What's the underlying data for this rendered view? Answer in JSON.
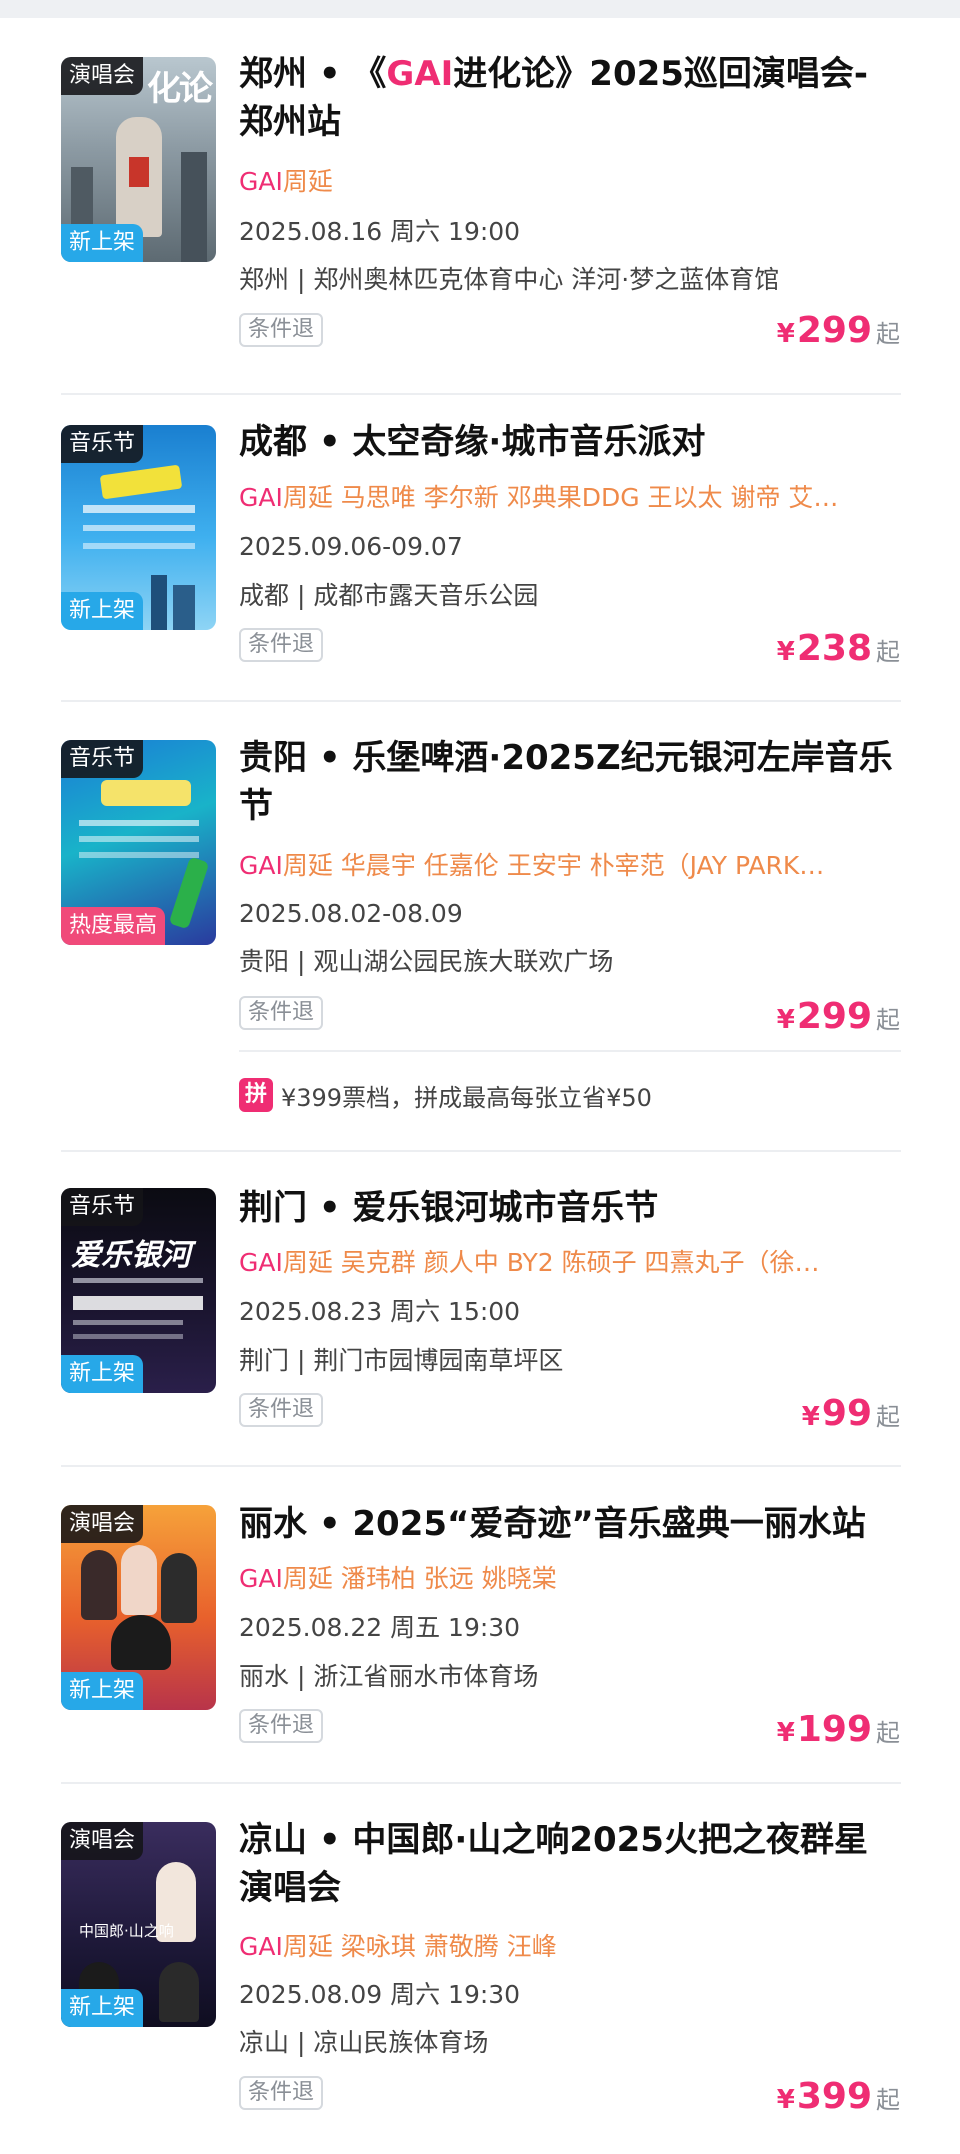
{
  "events": [
    {
      "tag": "演唱会",
      "badge": "新上架",
      "title_parts": [
        "郑州 • 《",
        "GAI",
        "进化论》2025巡回演唱会-郑州站"
      ],
      "artists": "GAI周延",
      "datetime": "2025.08.16 周六 19:00",
      "venue": "郑州 | 郑州奥林匹克体育中心 洋河·梦之蓝体育馆",
      "refund": "条件退",
      "price_currency": "¥",
      "price": "299",
      "price_suffix": "起",
      "poster_text": "化论"
    },
    {
      "tag": "音乐节",
      "badge": "新上架",
      "title": "成都 • 太空奇缘·城市音乐派对",
      "artists": "GAI周延 马思唯 李尔新 邓典果DDG 王以太 谢帝 艾…",
      "datetime": "2025.09.06-09.07",
      "venue": "成都 | 成都市露天音乐公园",
      "refund": "条件退",
      "price_currency": "¥",
      "price": "238",
      "price_suffix": "起"
    },
    {
      "tag": "音乐节",
      "badge": "热度最高",
      "title": "贵阳 • 乐堡啤酒·2025Z纪元银河左岸音乐节",
      "artists": "GAI周延 华晨宇 任嘉伦 王安宇 朴宰范（JAY PARK…",
      "datetime": "2025.08.02-08.09",
      "venue": "贵阳 | 观山湖公园民族大联欢广场",
      "refund": "条件退",
      "price_currency": "¥",
      "price": "299",
      "price_suffix": "起",
      "promo_icon": "拼",
      "promo_text": "¥399票档，拼成最高每张立省¥50"
    },
    {
      "tag": "音乐节",
      "badge": "新上架",
      "title": "荆门 • 爱乐银河城市音乐节",
      "artists": "GAI周延 吴克群 颜人中 BY2 陈硕子 四熹丸子（徐…",
      "datetime": "2025.08.23 周六 15:00",
      "venue": "荆门 | 荆门市园博园南草坪区",
      "refund": "条件退",
      "price_currency": "¥",
      "price": "99",
      "price_suffix": "起",
      "poster_text": "爱乐银河"
    },
    {
      "tag": "演唱会",
      "badge": "新上架",
      "title": "丽水 • 2025“爱奇迹”音乐盛典一丽水站",
      "artists": "GAI周延 潘玮柏 张远 姚晓棠",
      "datetime": "2025.08.22 周五 19:30",
      "venue": "丽水 | 浙江省丽水市体育场",
      "refund": "条件退",
      "price_currency": "¥",
      "price": "199",
      "price_suffix": "起"
    },
    {
      "tag": "演唱会",
      "badge": "新上架",
      "title": "凉山 • 中国郎·山之响2025火把之夜群星演唱会",
      "artists": "GAI周延 梁咏琪 萧敬腾 汪峰",
      "datetime": "2025.08.09 周六 19:30",
      "venue": "凉山 | 凉山民族体育场",
      "refund": "条件退",
      "price_currency": "¥",
      "price": "399",
      "price_suffix": "起",
      "poster_text": "中国郎·山之响"
    }
  ],
  "colors": {
    "accent_pink": "#ef2d73",
    "artist_orange": "#ef8a4a",
    "badge_new": "#27a8e8",
    "badge_hot": "#f04a7a"
  }
}
